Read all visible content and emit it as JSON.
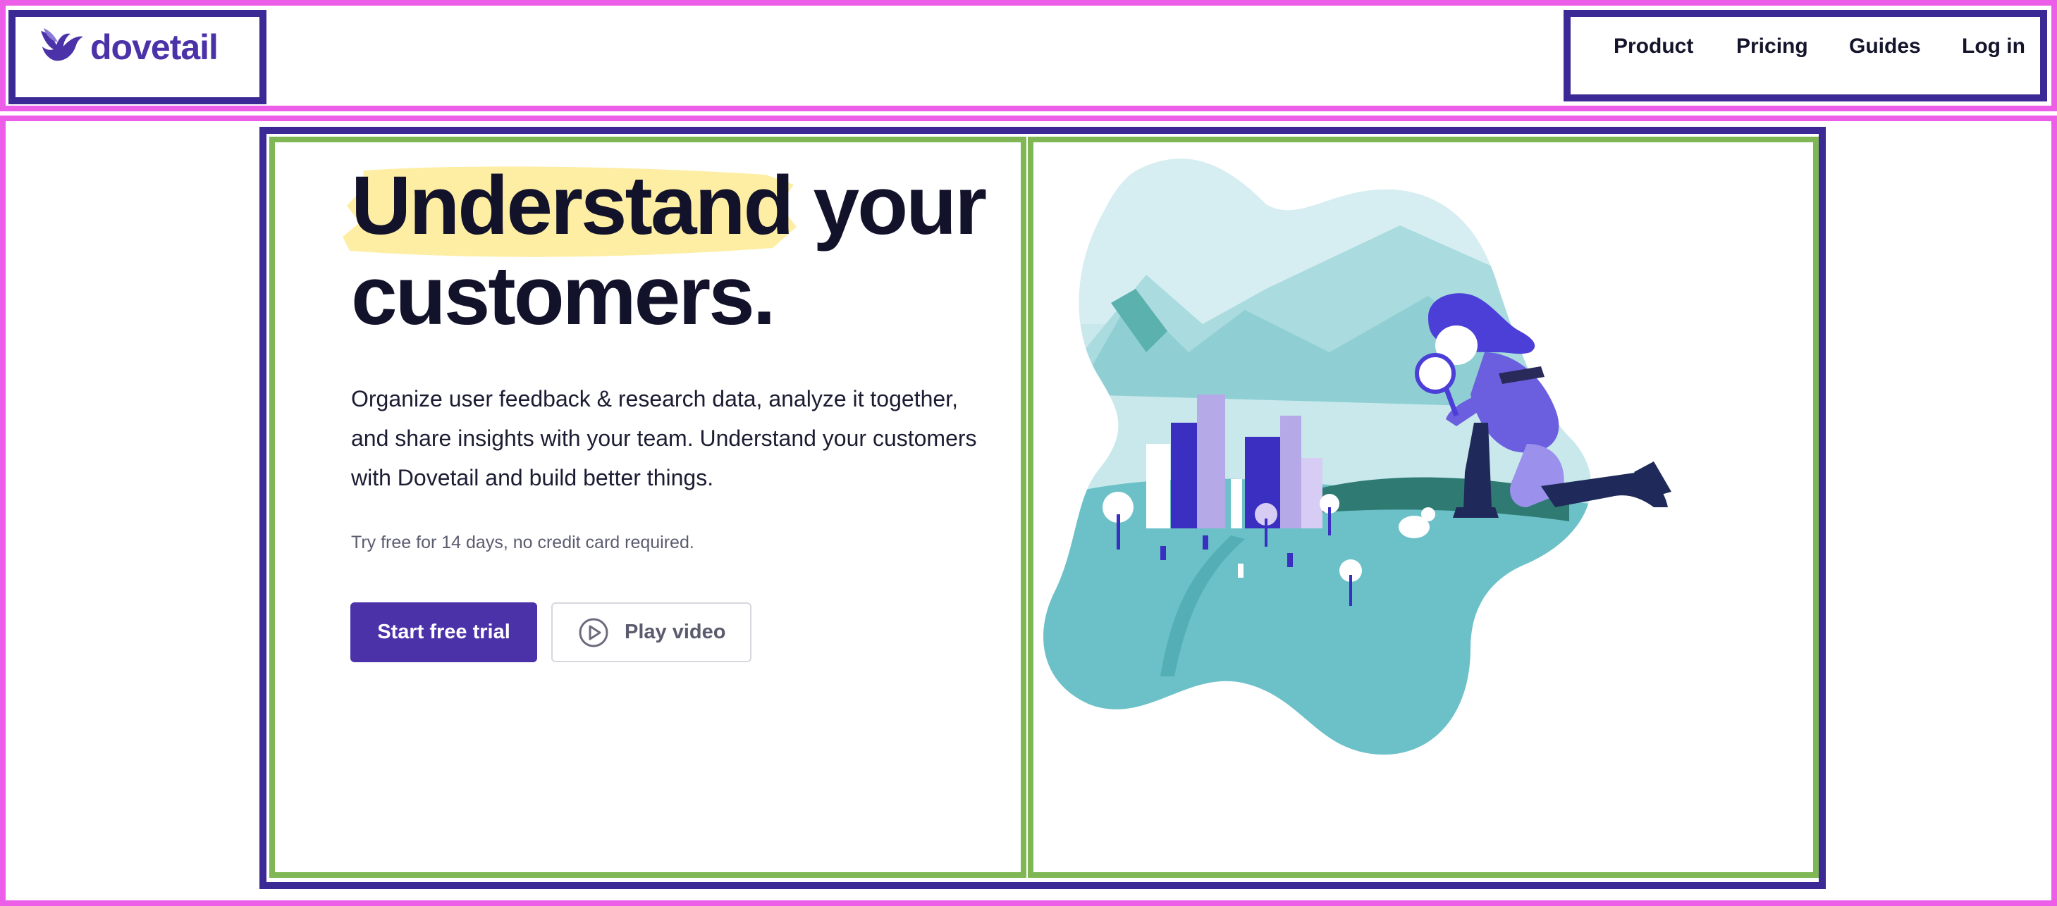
{
  "brand": {
    "name": "dovetail",
    "color": "#4b32a8",
    "logo_icon": "dove-bird-icon"
  },
  "nav": {
    "items": [
      {
        "label": "Product"
      },
      {
        "label": "Pricing"
      },
      {
        "label": "Guides"
      },
      {
        "label": "Log in"
      }
    ]
  },
  "hero": {
    "headline_word_1": "Understand",
    "headline_rest_line_1": "your",
    "headline_line_2": "customers.",
    "lead": "Organize user feedback & research data, analyze it together, and share insights with your team. Understand your customers with Dovetail and build better things.",
    "note": "Try free for 14 days, no credit card required.",
    "primary_cta": "Start free trial",
    "secondary_cta": "Play video",
    "secondary_cta_icon": "play-circle-icon",
    "highlight_color": "#fdeea4"
  },
  "illustration": {
    "name": "detective-with-magnifier-city-scene"
  },
  "colors": {
    "accent": "#4b32a8",
    "annotation_pink": "#ec5de8",
    "annotation_navy": "#3b2a96",
    "annotation_green": "#7fb755"
  }
}
